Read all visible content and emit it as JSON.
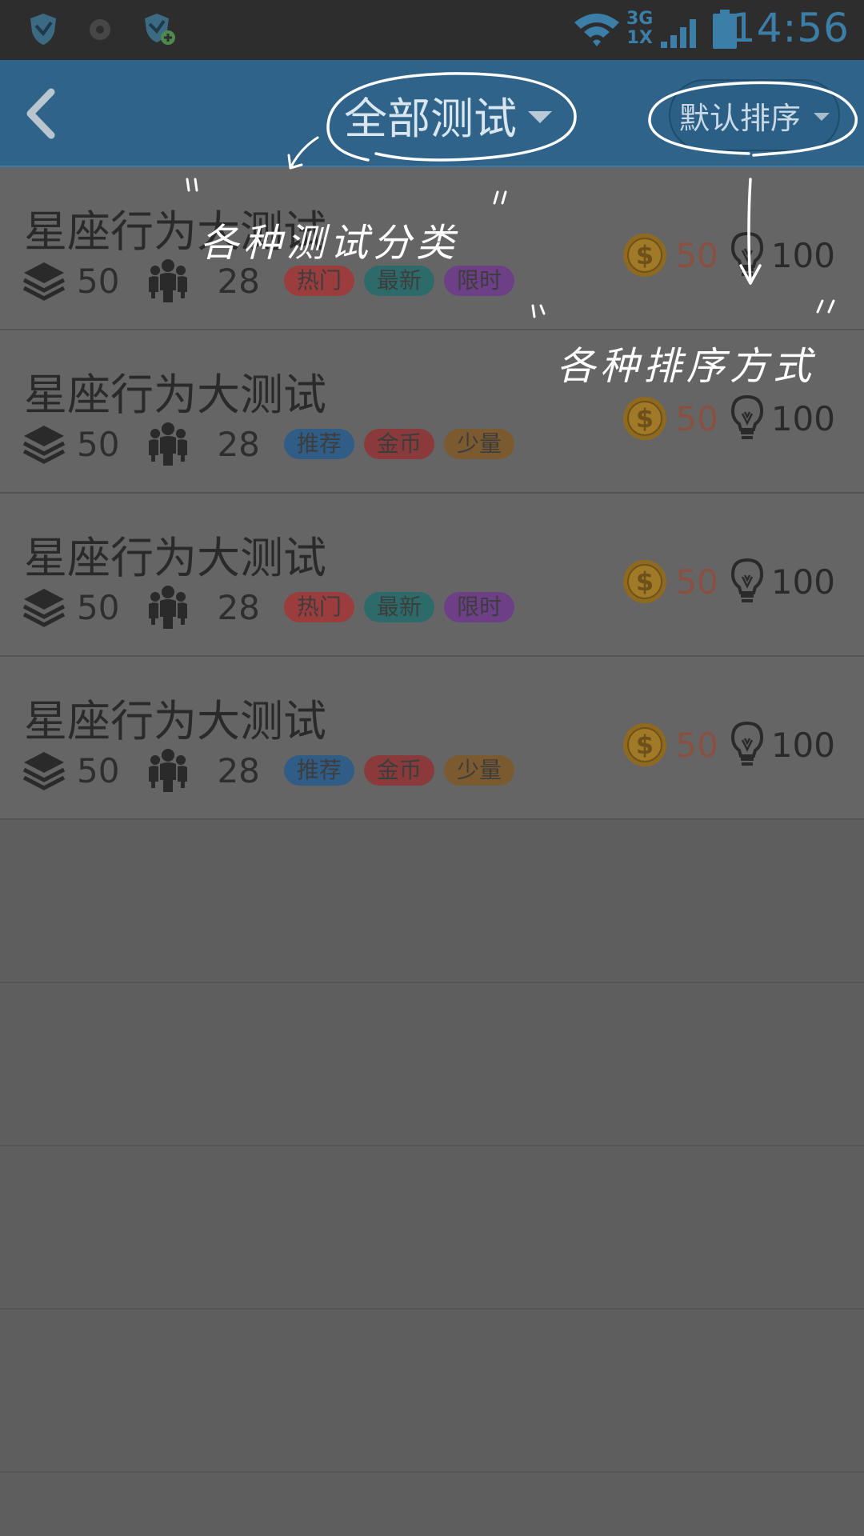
{
  "status_bar": {
    "time": "14:56",
    "network_top": "3G",
    "network_bottom": "1X",
    "icons": [
      "shield-icon",
      "record-icon",
      "shield-plus-icon",
      "wifi-icon",
      "signal-icon",
      "battery-icon"
    ]
  },
  "header": {
    "title": "全部测试",
    "sort_label": "默认排序",
    "icons": [
      "back-arrow-icon",
      "caret-down-icon"
    ]
  },
  "rows": [
    {
      "title": "星座行为大测试",
      "count": "50",
      "people": "28",
      "coins": "50",
      "bulbs": "100",
      "tags": [
        {
          "label": "热门",
          "color": "#9b3d3d"
        },
        {
          "label": "最新",
          "color": "#2d6b6b"
        },
        {
          "label": "限时",
          "color": "#6c3f86"
        }
      ]
    },
    {
      "title": "星座行为大测试",
      "count": "50",
      "people": "28",
      "coins": "50",
      "bulbs": "100",
      "tags": [
        {
          "label": "推荐",
          "color": "#2f5d86"
        },
        {
          "label": "金币",
          "color": "#8a3a3a"
        },
        {
          "label": "少量",
          "color": "#7a5a2e"
        }
      ]
    },
    {
      "title": "星座行为大测试",
      "count": "50",
      "people": "28",
      "coins": "50",
      "bulbs": "100",
      "tags": [
        {
          "label": "热门",
          "color": "#9b3d3d"
        },
        {
          "label": "最新",
          "color": "#2d6b6b"
        },
        {
          "label": "限时",
          "color": "#6c3f86"
        }
      ]
    },
    {
      "title": "星座行为大测试",
      "count": "50",
      "people": "28",
      "coins": "50",
      "bulbs": "100",
      "tags": [
        {
          "label": "推荐",
          "color": "#2f5d86"
        },
        {
          "label": "金币",
          "color": "#8a3a3a"
        },
        {
          "label": "少量",
          "color": "#7a5a2e"
        }
      ]
    }
  ],
  "annotations": {
    "category": "各种测试分类",
    "sort": "各种排序方式"
  },
  "colors": {
    "header_bg": "#2f6389",
    "overlay_bg": "#5e5e5e",
    "coin_text": "#8a4f40",
    "annotation": "#ffffff"
  }
}
